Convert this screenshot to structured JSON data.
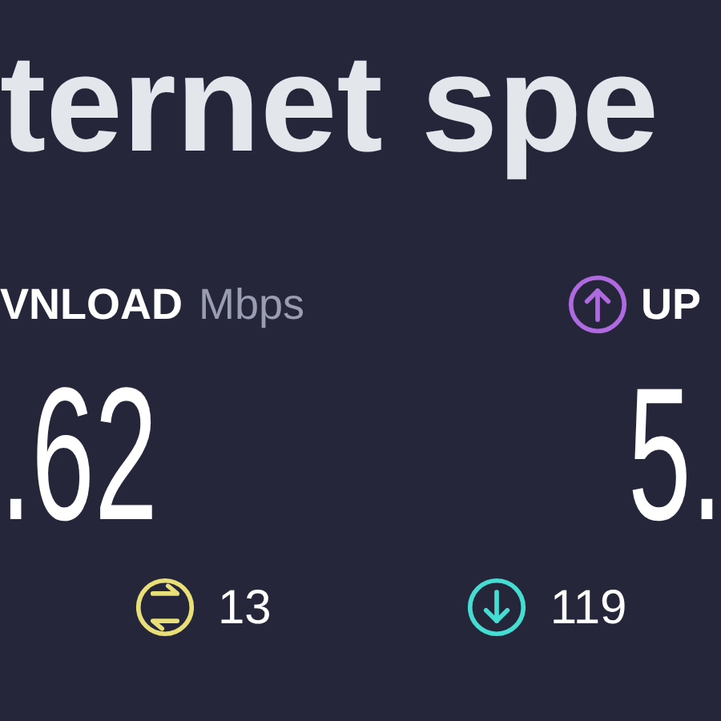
{
  "title": "ternet spe",
  "download": {
    "label": "VNLOAD",
    "unit": "Mbps",
    "value": ".62"
  },
  "upload": {
    "label": "UP",
    "value": "5."
  },
  "pings": [
    {
      "kind": "swap",
      "value": "13",
      "color": "#e8df78"
    },
    {
      "kind": "down",
      "value": "119",
      "color": "#45dcd2"
    }
  ]
}
